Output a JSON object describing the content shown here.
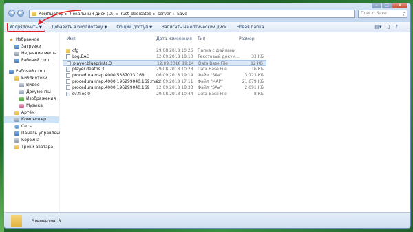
{
  "address": {
    "crumbs": [
      "Компьютер",
      "Локальный диск (D:)",
      "rust_dedicated",
      "server",
      "Save"
    ]
  },
  "search": {
    "placeholder": "Поиск: Save"
  },
  "toolbar": {
    "organize": "Упорядочить",
    "add_library": "Добавить в библиотеку",
    "share": "Общий доступ",
    "burn": "Записать на оптический диск",
    "new_folder": "Новая папка"
  },
  "sidebar": {
    "items": [
      {
        "label": "Избранное",
        "icon": "star-icon"
      },
      {
        "label": "Загрузки",
        "icon": "downloads-folder-icon"
      },
      {
        "label": "Недавние места",
        "icon": "recent-places-icon"
      },
      {
        "label": "Рабочий стол",
        "icon": "desktop-icon"
      },
      {
        "label": "Рабочий стол",
        "icon": "desktop-icon"
      },
      {
        "label": "Библиотеки",
        "icon": "libraries-icon"
      },
      {
        "label": "Видео",
        "icon": "video-icon"
      },
      {
        "label": "Документы",
        "icon": "documents-icon"
      },
      {
        "label": "Изображения",
        "icon": "pictures-icon"
      },
      {
        "label": "Музыка",
        "icon": "music-icon"
      },
      {
        "label": "Артём",
        "icon": "user-icon"
      },
      {
        "label": "Компьютер",
        "icon": "computer-icon"
      },
      {
        "label": "Сеть",
        "icon": "network-icon"
      },
      {
        "label": "Панель управления",
        "icon": "control-panel-icon"
      },
      {
        "label": "Корзина",
        "icon": "recycle-bin-icon"
      },
      {
        "label": "Треки аватара",
        "icon": "folder-icon"
      }
    ]
  },
  "columns": {
    "name": "Имя",
    "date": "Дата изменения",
    "type": "Тип",
    "size": "Размер"
  },
  "files": [
    {
      "name": "cfg",
      "date": "29.08.2018 10:26",
      "type": "Папка с файлами",
      "size": "",
      "kind": "folder"
    },
    {
      "name": "Log.EAC",
      "date": "12.09.2018 18:10",
      "type": "Текстовый докум...",
      "size": "33 КБ",
      "kind": "txt"
    },
    {
      "name": "player.blueprints.3",
      "date": "12.09.2018 19:14",
      "type": "Data Base File",
      "size": "12 КБ",
      "kind": "dat"
    },
    {
      "name": "player.deaths.3",
      "date": "29.08.2018 10:28",
      "type": "Data Base File",
      "size": "16 КБ",
      "kind": "dat"
    },
    {
      "name": "proceduralmap.4000.5387033.168",
      "date": "06.09.2018 19:14",
      "type": "Файл \"SAV\"",
      "size": "3 123 КБ",
      "kind": "file"
    },
    {
      "name": "proceduralmap.4000.196299040.169.map",
      "date": "12.09.2018 17:11",
      "type": "Файл \"MAP\"",
      "size": "21 679 КБ",
      "kind": "file"
    },
    {
      "name": "proceduralmap.4000.196299040.169",
      "date": "12.09.2018 18:33",
      "type": "Файл \"SAV\"",
      "size": "2 691 КБ",
      "kind": "file"
    },
    {
      "name": "sv.files.0",
      "date": "29.08.2018 10:44",
      "type": "Data Base File",
      "size": "8 КБ",
      "kind": "dat"
    }
  ],
  "status": {
    "text": "Элементов: 8"
  }
}
